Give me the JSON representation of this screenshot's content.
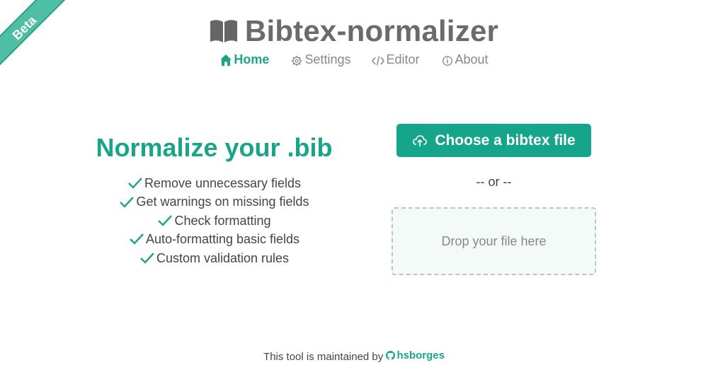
{
  "ribbon": {
    "label": "Beta",
    "color": "#4fbfa3"
  },
  "header": {
    "title": "Bibtex-normalizer",
    "icon": "book-icon"
  },
  "nav": {
    "items": [
      {
        "label": "Home",
        "icon": "home-icon",
        "active": true
      },
      {
        "label": "Settings",
        "icon": "gear-icon",
        "active": false
      },
      {
        "label": "Editor",
        "icon": "code-icon",
        "active": false
      },
      {
        "label": "About",
        "icon": "info-icon",
        "active": false
      }
    ]
  },
  "main": {
    "headline": "Normalize your .bib",
    "features": [
      "Remove unnecessary fields",
      "Get warnings on missing fields",
      "Check formatting",
      "Auto-formatting basic fields",
      "Custom validation rules"
    ],
    "choose_button": "Choose a bibtex file",
    "or_text": "-- or --",
    "dropzone": "Drop your file here"
  },
  "footer": {
    "text": "This tool is maintained by",
    "author": "hsborges",
    "author_icon": "github-icon"
  },
  "colors": {
    "accent": "#1aa48a",
    "button": "#14a58b",
    "muted": "#888888"
  }
}
